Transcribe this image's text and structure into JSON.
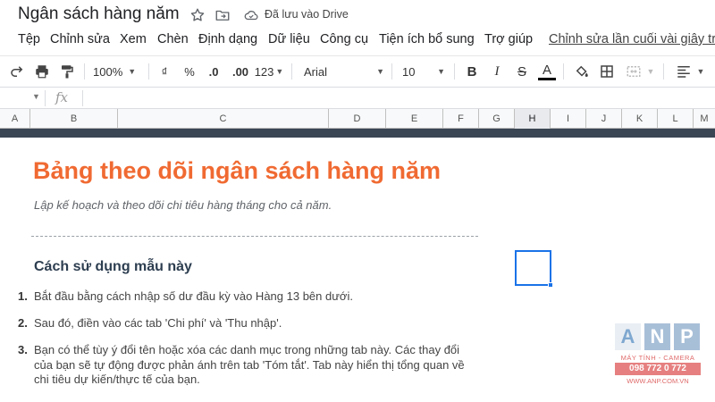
{
  "titlebar": {
    "doc_title": "Ngân sách hàng năm",
    "saved_status": "Đã lưu vào Drive",
    "icons": [
      "star-icon",
      "move-to-folder-icon",
      "cloud-saved-icon"
    ]
  },
  "menu": {
    "items": [
      "Tệp",
      "Chỉnh sửa",
      "Xem",
      "Chèn",
      "Định dạng",
      "Dữ liệu",
      "Công cụ",
      "Tiện ích bổ sung",
      "Trợ giúp"
    ],
    "last_edit": "Chỉnh sửa lần cuối vài giây trư"
  },
  "toolbar": {
    "zoom": "100%",
    "currency": "₫",
    "percent": "%",
    "decimal_decrease": ".0",
    "decimal_increase": ".00",
    "more_formats": "123",
    "font": "Arial",
    "font_size": "10",
    "bold": "B",
    "italic": "I",
    "strikethrough": "S",
    "text_color": "A"
  },
  "formula_bar": {
    "fx": "fx",
    "value": ""
  },
  "columns": [
    "A",
    "B",
    "C",
    "D",
    "E",
    "F",
    "G",
    "H",
    "I",
    "J",
    "K",
    "L",
    "M"
  ],
  "active_column": "H",
  "sheet": {
    "title": "Bảng theo dõi ngân sách hàng năm",
    "subtitle": "Lập kế hoạch và theo dõi chi tiêu hàng tháng cho cả năm.",
    "section_heading": "Cách sử dụng mẫu này",
    "steps": [
      {
        "num": "1.",
        "text": "Bắt đầu bằng cách nhập số dư đầu kỳ vào Hàng 13 bên dưới."
      },
      {
        "num": "2.",
        "text": "Sau đó, điền vào các tab 'Chi phí' và 'Thu nhập'."
      },
      {
        "num": "3.",
        "text": "Bạn có thể tùy ý đổi tên hoặc xóa các danh mục trong những tab này. Các thay đổi của bạn sẽ tự động được phản ánh trên tab 'Tóm tắt'. Tab này hiển thị tổng quan về chi tiêu dự kiến/thực tế của bạn."
      }
    ]
  },
  "watermark": {
    "letters": [
      "A",
      "N",
      "P"
    ],
    "subtitle": "MÁY TÍNH - CAMERA",
    "phone": "098 772 0 772",
    "website": "WWW.ANP.COM.VN"
  },
  "colors": {
    "title_orange": "#f06a32",
    "heading_navy": "#2d3e50",
    "selection_blue": "#1a73e8",
    "header_strip": "#3b4654"
  }
}
